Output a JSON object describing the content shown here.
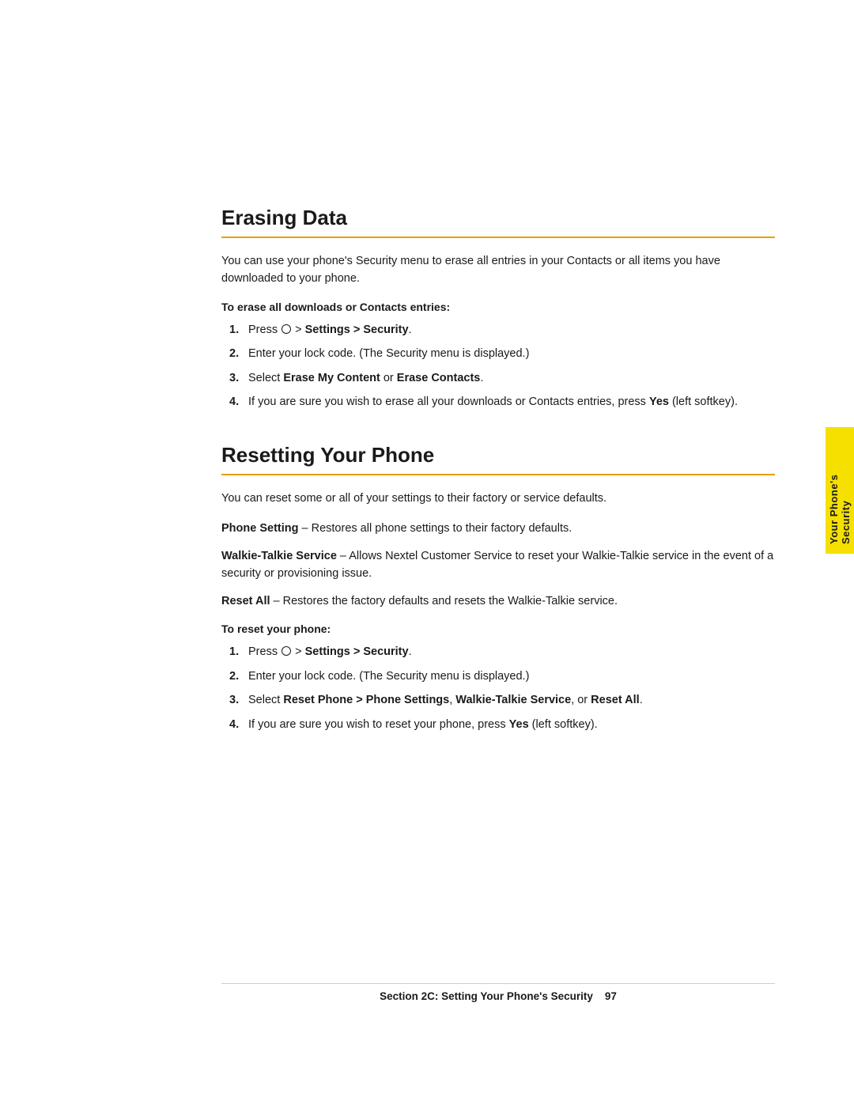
{
  "page": {
    "background": "#ffffff"
  },
  "erasing_section": {
    "title": "Erasing Data",
    "intro": "You can use your phone's Security menu to erase all entries in your Contacts or all items you have downloaded to your phone.",
    "sub_heading": "To erase all downloads or Contacts entries:",
    "steps": [
      {
        "num": "1.",
        "text_before": "Press ",
        "circle": true,
        "text_middle": " > ",
        "bold": "Settings > Security",
        "text_after": "."
      },
      {
        "num": "2.",
        "text": "Enter your lock code. (The Security menu is displayed.)"
      },
      {
        "num": "3.",
        "text_before": "Select ",
        "bold1": "Erase My Content",
        "text_middle": " or ",
        "bold2": "Erase Contacts",
        "text_after": "."
      },
      {
        "num": "4.",
        "text_before": "If you are sure you wish to erase all your downloads or Contacts entries, press ",
        "bold": "Yes",
        "text_after": " (left softkey)."
      }
    ]
  },
  "resetting_section": {
    "title": "Resetting Your Phone",
    "intro": "You can reset some or all of your settings to their factory or service defaults.",
    "definitions": [
      {
        "term": "Phone Setting",
        "separator": " – ",
        "description": "Restores all phone settings to their factory defaults."
      },
      {
        "term": "Walkie-Talkie Service",
        "separator": " – ",
        "description": "Allows Nextel Customer Service to reset your Walkie-Talkie service in the event of a security or provisioning issue."
      },
      {
        "term": "Reset All",
        "separator": " – ",
        "description": "Restores the factory defaults and resets the Walkie-Talkie service."
      }
    ],
    "sub_heading": "To reset your phone:",
    "steps": [
      {
        "num": "1.",
        "text_before": "Press ",
        "circle": true,
        "text_middle": " > ",
        "bold": "Settings > Security",
        "text_after": "."
      },
      {
        "num": "2.",
        "text": "Enter your lock code. (The Security menu is displayed.)"
      },
      {
        "num": "3.",
        "text_before": "Select ",
        "bold1": "Reset Phone > Phone Settings",
        "text_middle": ", ",
        "bold2": "Walkie-Talkie Service",
        "text_mid2": ", or ",
        "bold3": "Reset All",
        "text_after": "."
      },
      {
        "num": "4.",
        "text_before": "If you are sure you wish to reset your phone, press ",
        "bold": "Yes",
        "text_after": " (left softkey)."
      }
    ]
  },
  "side_tab": {
    "label": "Your Phone's Security"
  },
  "footer": {
    "text": "Section 2C: Setting Your Phone's Security",
    "page_number": "97"
  }
}
